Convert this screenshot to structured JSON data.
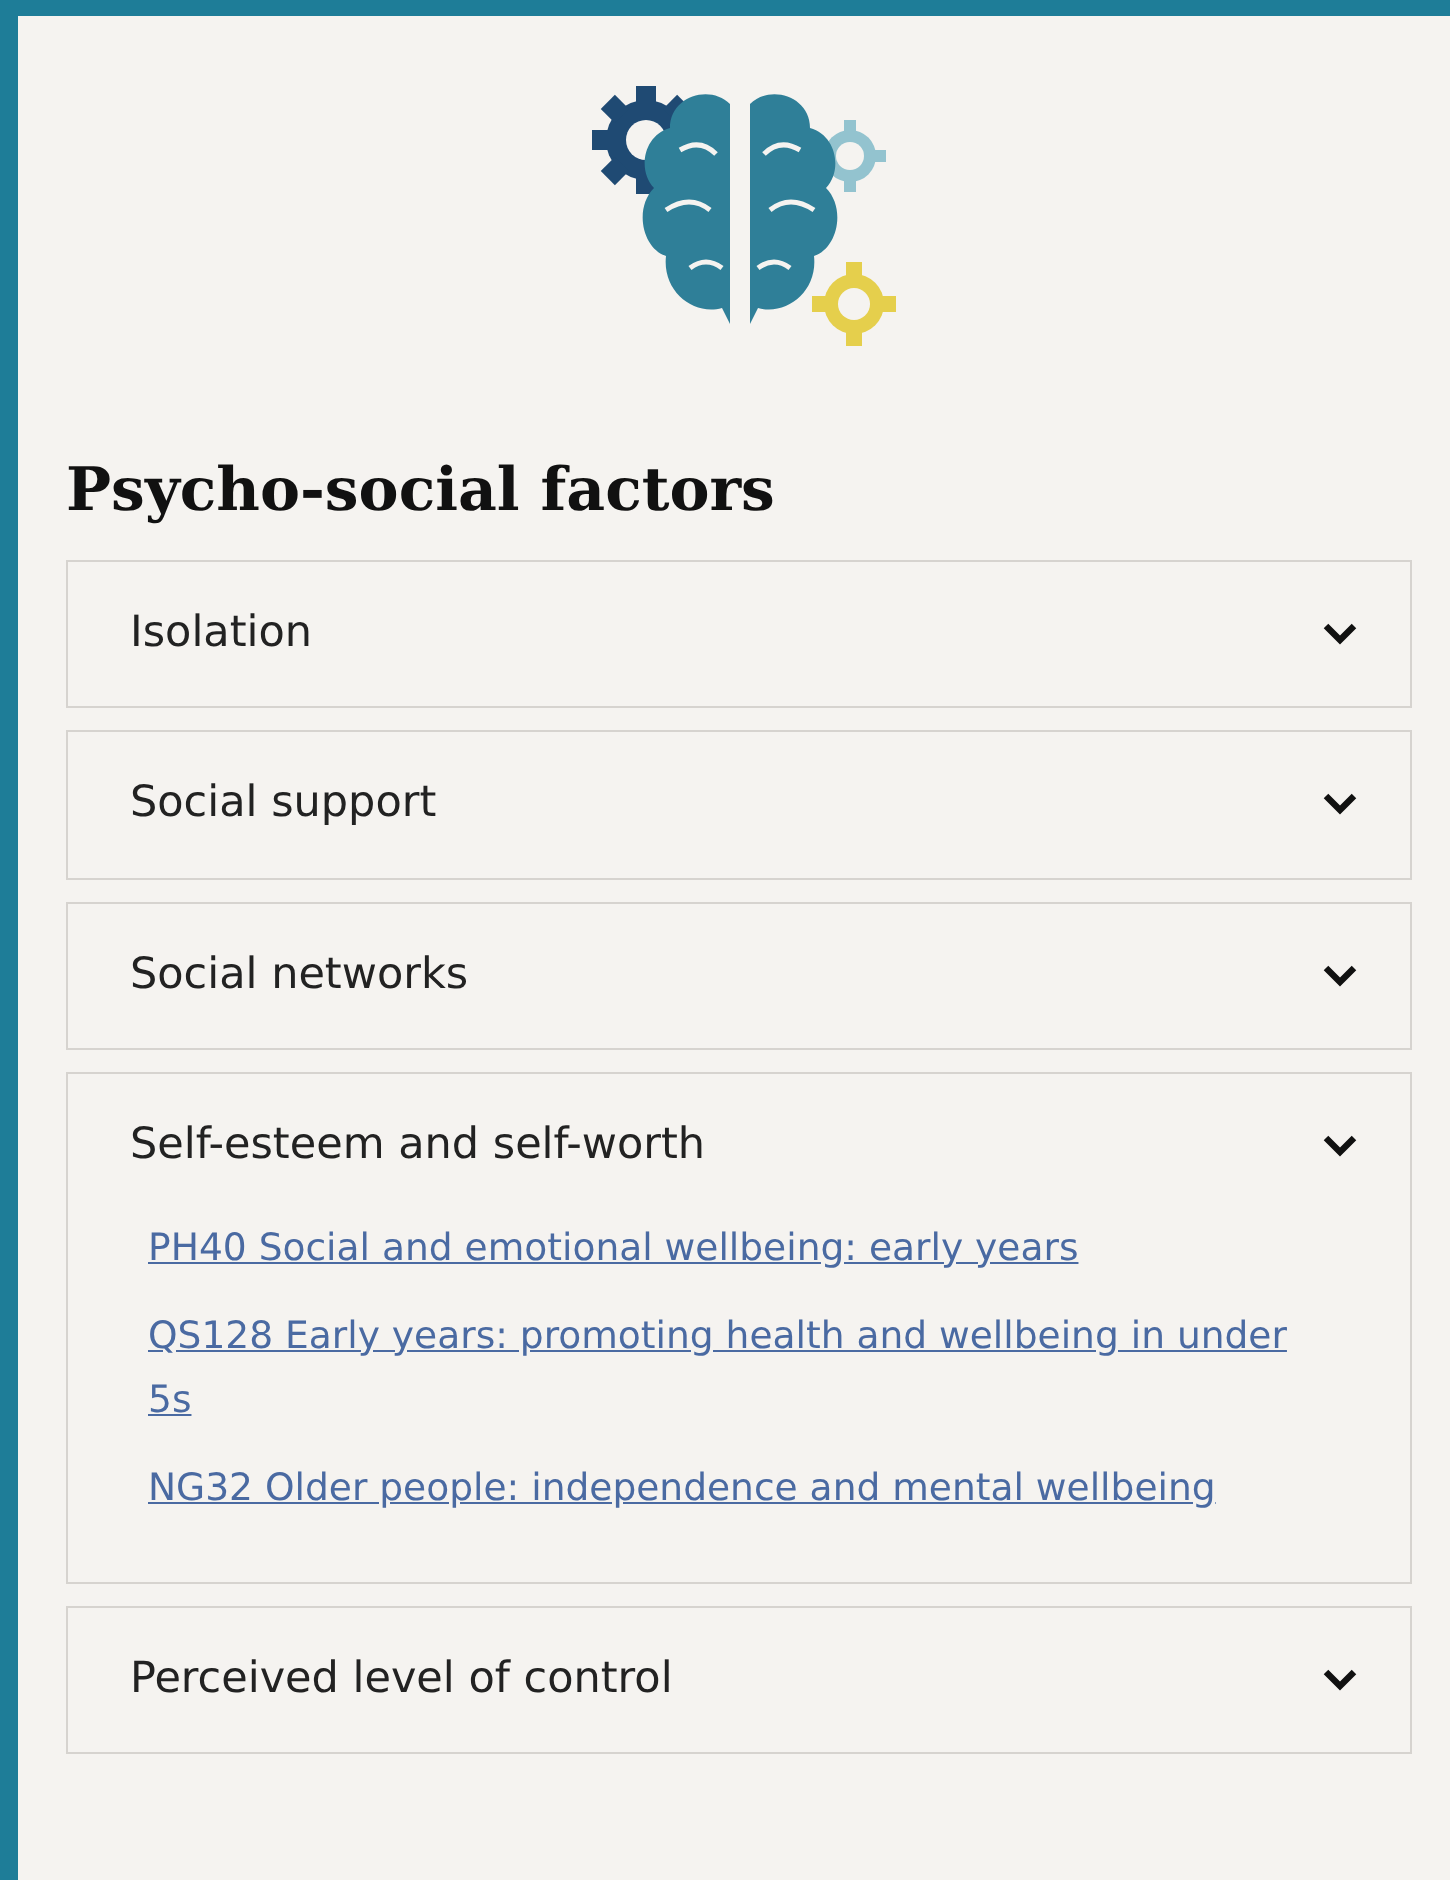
{
  "heading": "Psycho-social factors",
  "sections": [
    {
      "title": "Isolation"
    },
    {
      "title": "Social support"
    },
    {
      "title": "Social networks"
    },
    {
      "title": "Self-esteem and self-worth",
      "links": [
        "PH40 Social and emotional wellbeing: early years",
        "QS128 Early years: promoting health and wellbeing in under 5s",
        "NG32 Older people: independence and mental wellbeing"
      ]
    },
    {
      "title": "Perceived level of control"
    }
  ]
}
